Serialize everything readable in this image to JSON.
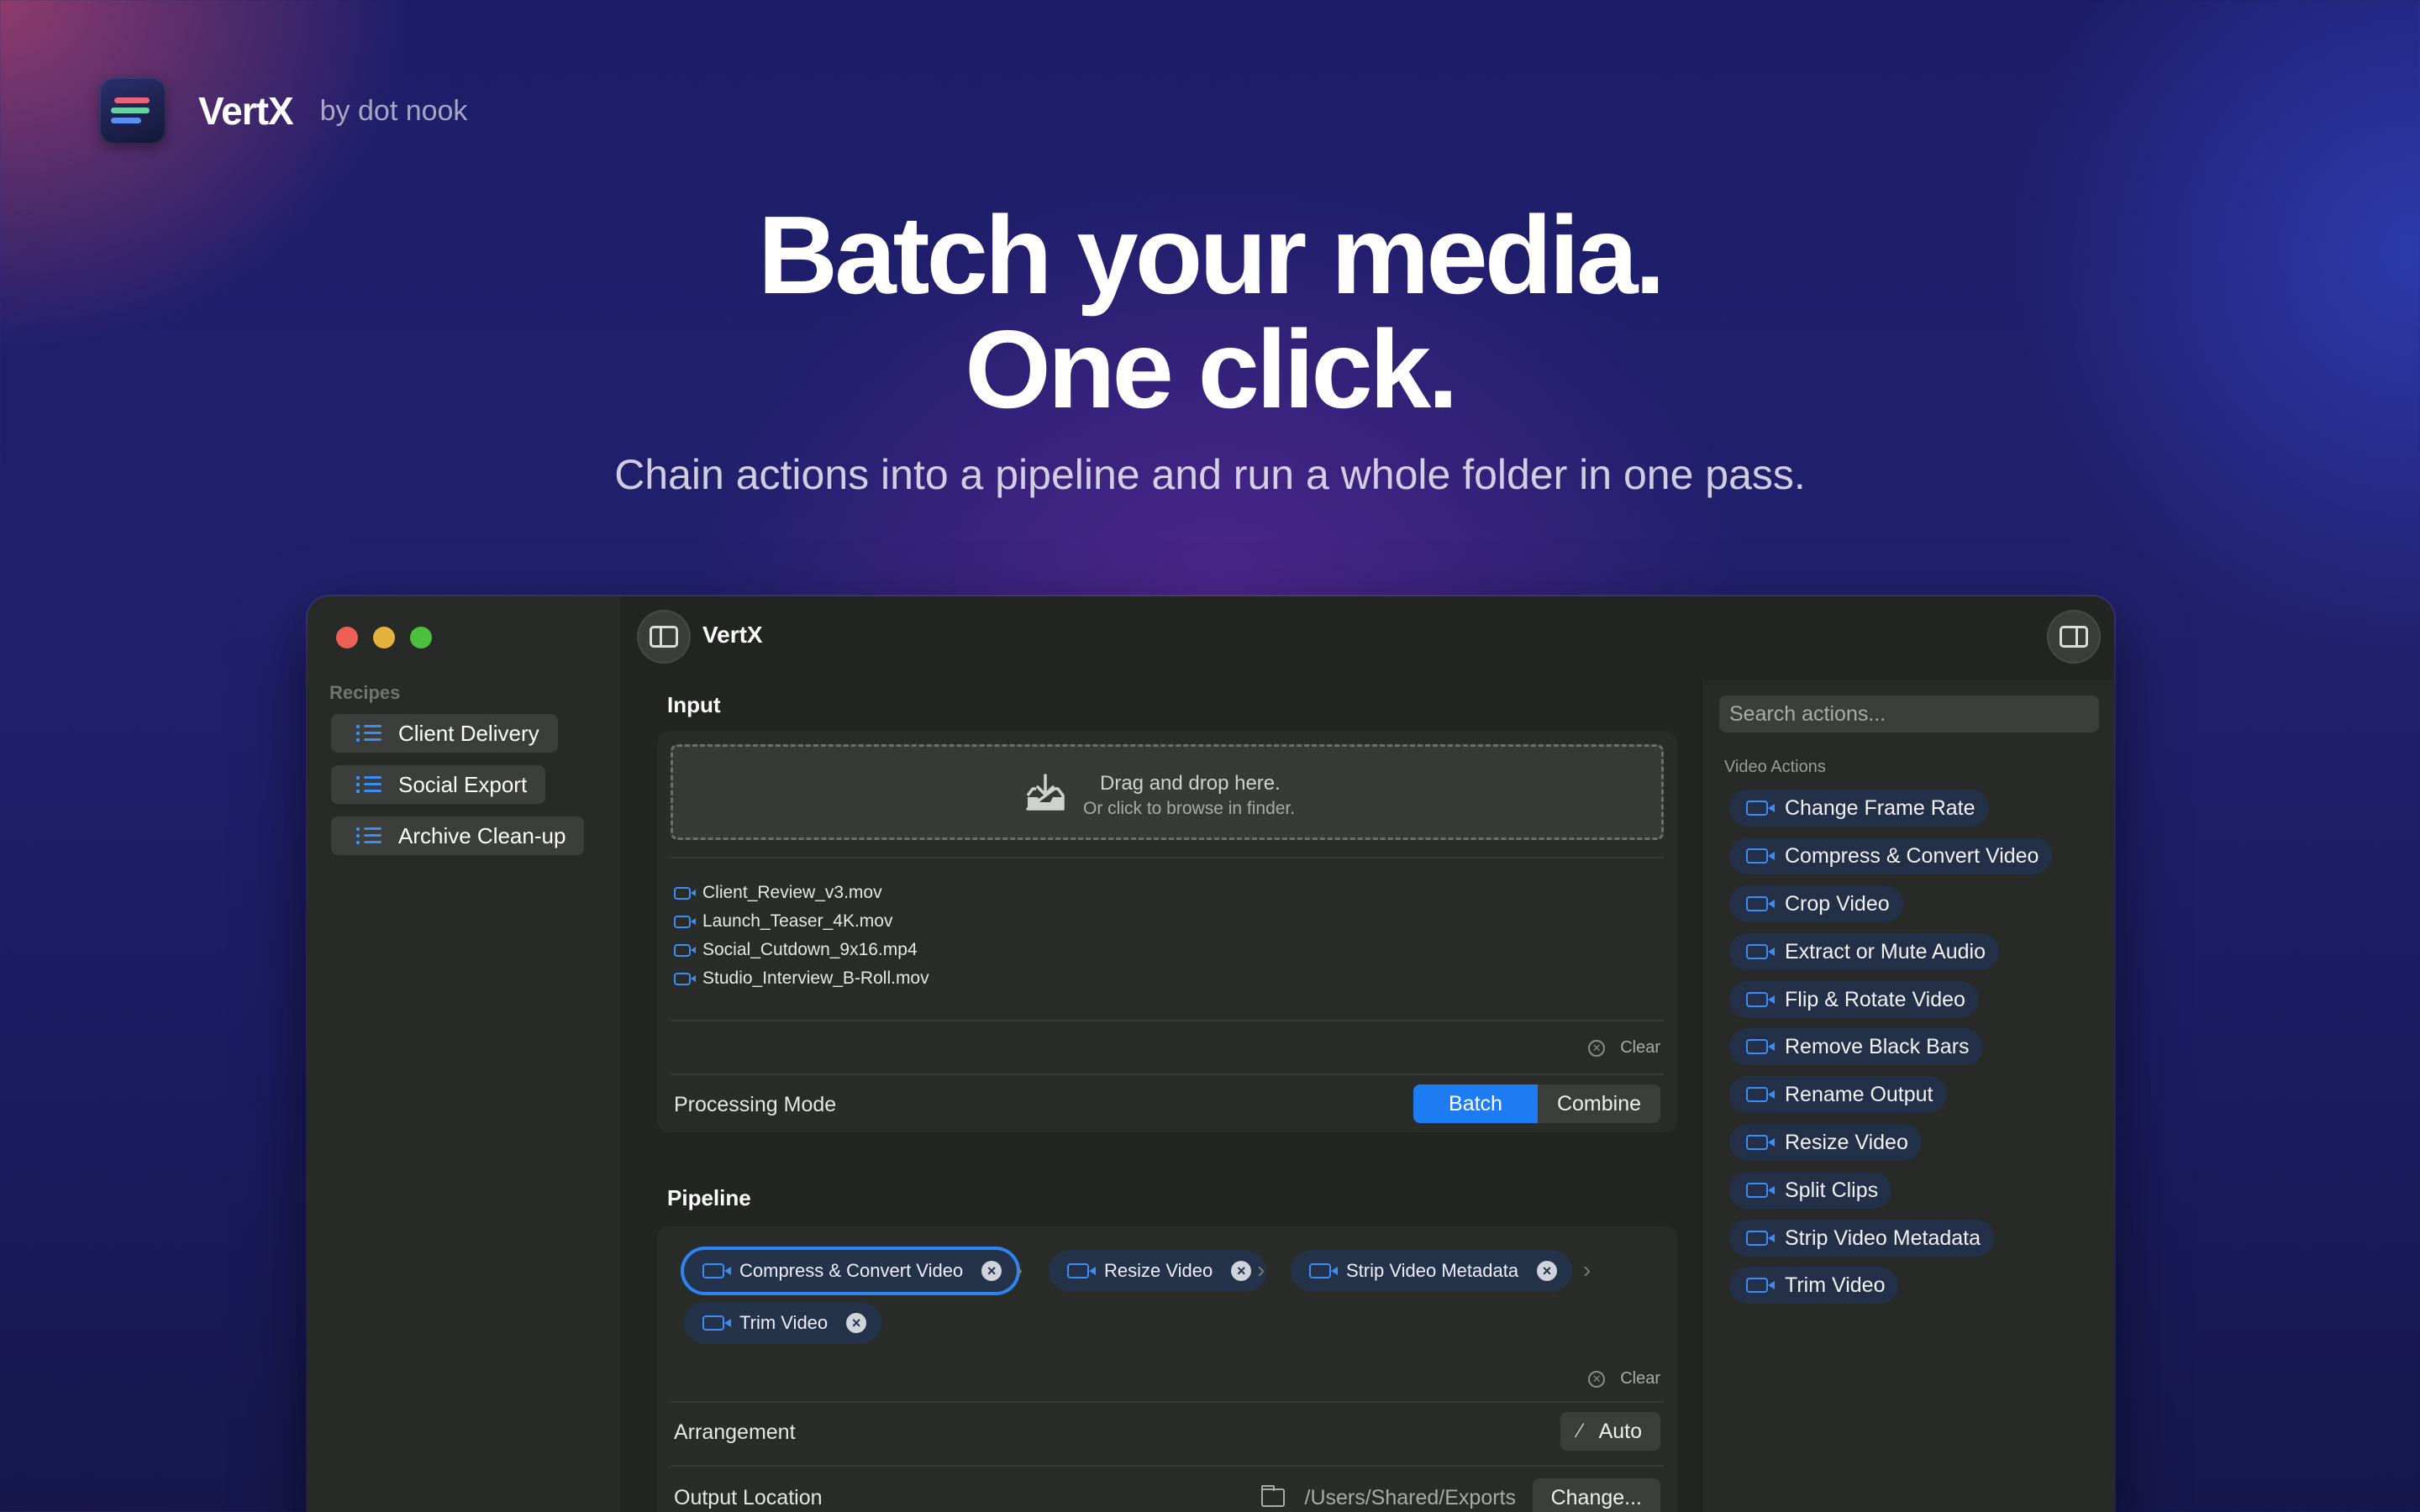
{
  "brand": {
    "name": "VertX",
    "by": "by dot nook"
  },
  "hero": {
    "title_line1": "Batch your media.",
    "title_line2": "One click.",
    "subtitle": "Chain actions into a pipeline and run a whole folder in one pass."
  },
  "window": {
    "title": "VertX",
    "sidebar": {
      "section": "Recipes",
      "recipes": [
        "Client Delivery",
        "Social Export",
        "Archive Clean-up"
      ]
    },
    "input": {
      "label": "Input",
      "drop_title": "Drag and drop here.",
      "drop_sub": "Or click to browse in finder.",
      "files": [
        "Client_Review_v3.mov",
        "Launch_Teaser_4K.mov",
        "Social_Cutdown_9x16.mp4",
        "Studio_Interview_B-Roll.mov"
      ],
      "clear_label": "Clear",
      "mode_label": "Processing Mode",
      "mode_options": [
        "Batch",
        "Combine"
      ],
      "mode_selected": "Batch"
    },
    "pipeline": {
      "label": "Pipeline",
      "steps": [
        "Compress & Convert Video",
        "Resize Video",
        "Strip Video Metadata",
        "Trim Video"
      ],
      "selected_step": "Compress & Convert Video",
      "clear_label": "Clear",
      "arrangement_label": "Arrangement",
      "arrangement_value": "Auto",
      "output_label": "Output Location",
      "output_path": "/Users/Shared/Exports",
      "change_label": "Change..."
    },
    "inspector": {
      "search_placeholder": "Search actions...",
      "section": "Video Actions",
      "actions": [
        "Change Frame Rate",
        "Compress & Convert Video",
        "Crop Video",
        "Extract or Mute Audio",
        "Flip & Rotate Video",
        "Remove Black Bars",
        "Rename Output",
        "Resize Video",
        "Split Clips",
        "Strip Video Metadata",
        "Trim Video"
      ]
    }
  },
  "colors": {
    "accent": "#1e7cf2",
    "icon_blue": "#3a8ef6",
    "chip_bg": "#24324a"
  }
}
